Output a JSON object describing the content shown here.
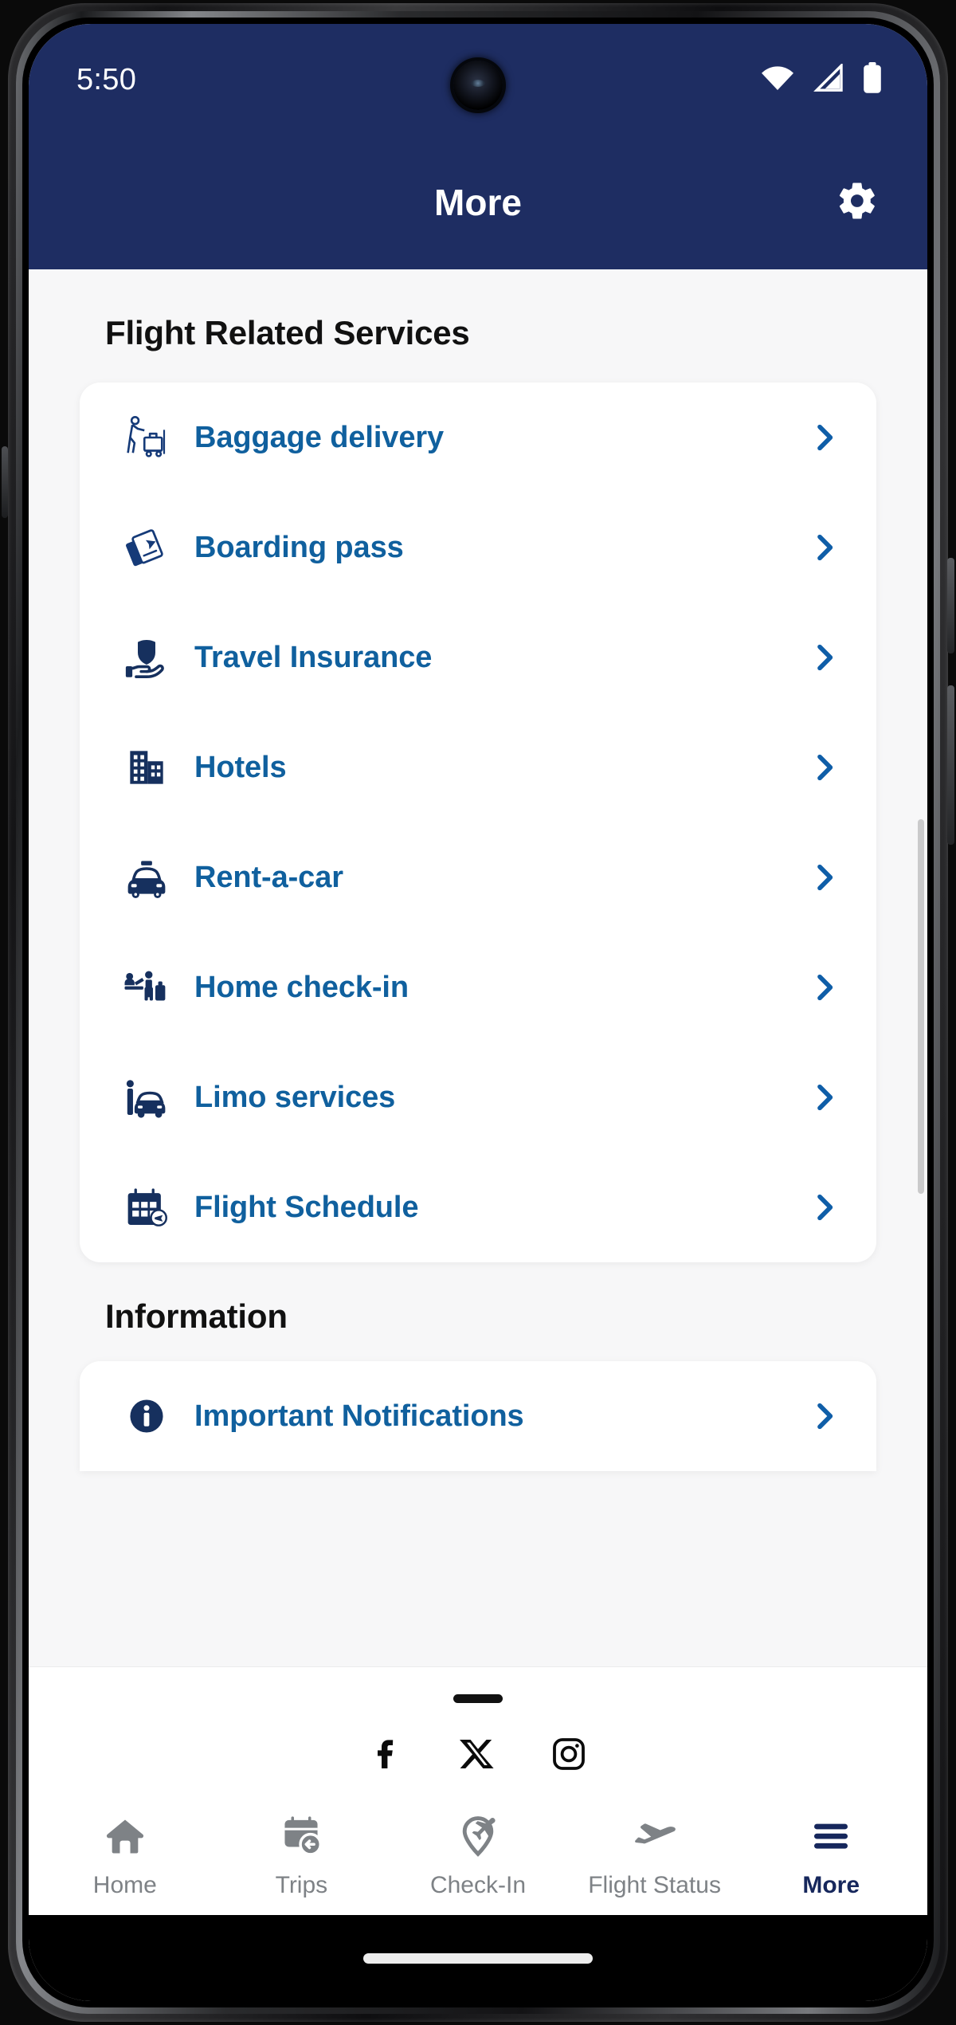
{
  "status_bar": {
    "time": "5:50",
    "icons": [
      "wifi-icon",
      "cellular-signal-icon",
      "battery-icon"
    ]
  },
  "app_bar": {
    "title": "More",
    "action_icon": "gear-icon"
  },
  "colors": {
    "header_navy": "#1e2d62",
    "link_blue": "#10609e",
    "icon_navy": "#153a78",
    "page_bg": "#f7f7f8",
    "card_bg": "#ffffff",
    "nav_inactive": "#7e8286",
    "nav_active": "#16275c"
  },
  "sections": [
    {
      "title": "Flight Related Services",
      "items": [
        {
          "label": "Baggage delivery",
          "icon": "baggage-porter-icon"
        },
        {
          "label": "Boarding pass",
          "icon": "boarding-pass-icon"
        },
        {
          "label": "Travel Insurance",
          "icon": "shield-hand-icon"
        },
        {
          "label": "Hotels",
          "icon": "buildings-icon"
        },
        {
          "label": "Rent-a-car",
          "icon": "taxi-car-icon"
        },
        {
          "label": "Home check-in",
          "icon": "home-checkin-icon"
        },
        {
          "label": "Limo services",
          "icon": "person-car-icon"
        },
        {
          "label": "Flight Schedule",
          "icon": "calendar-plane-icon"
        }
      ]
    },
    {
      "title": "Information",
      "items": [
        {
          "label": "Important Notifications",
          "icon": "info-circle-icon"
        }
      ]
    }
  ],
  "social_links": [
    {
      "name": "facebook-icon"
    },
    {
      "name": "x-twitter-icon"
    },
    {
      "name": "instagram-icon"
    }
  ],
  "bottom_nav": {
    "items": [
      {
        "label": "Home",
        "icon": "house-icon",
        "active": false
      },
      {
        "label": "Trips",
        "icon": "calendar-back-icon",
        "active": false
      },
      {
        "label": "Check-In",
        "icon": "checkin-pin-icon",
        "active": false
      },
      {
        "label": "Flight Status",
        "icon": "airplane-icon",
        "active": false
      },
      {
        "label": "More",
        "icon": "hamburger-icon",
        "active": true
      }
    ]
  }
}
